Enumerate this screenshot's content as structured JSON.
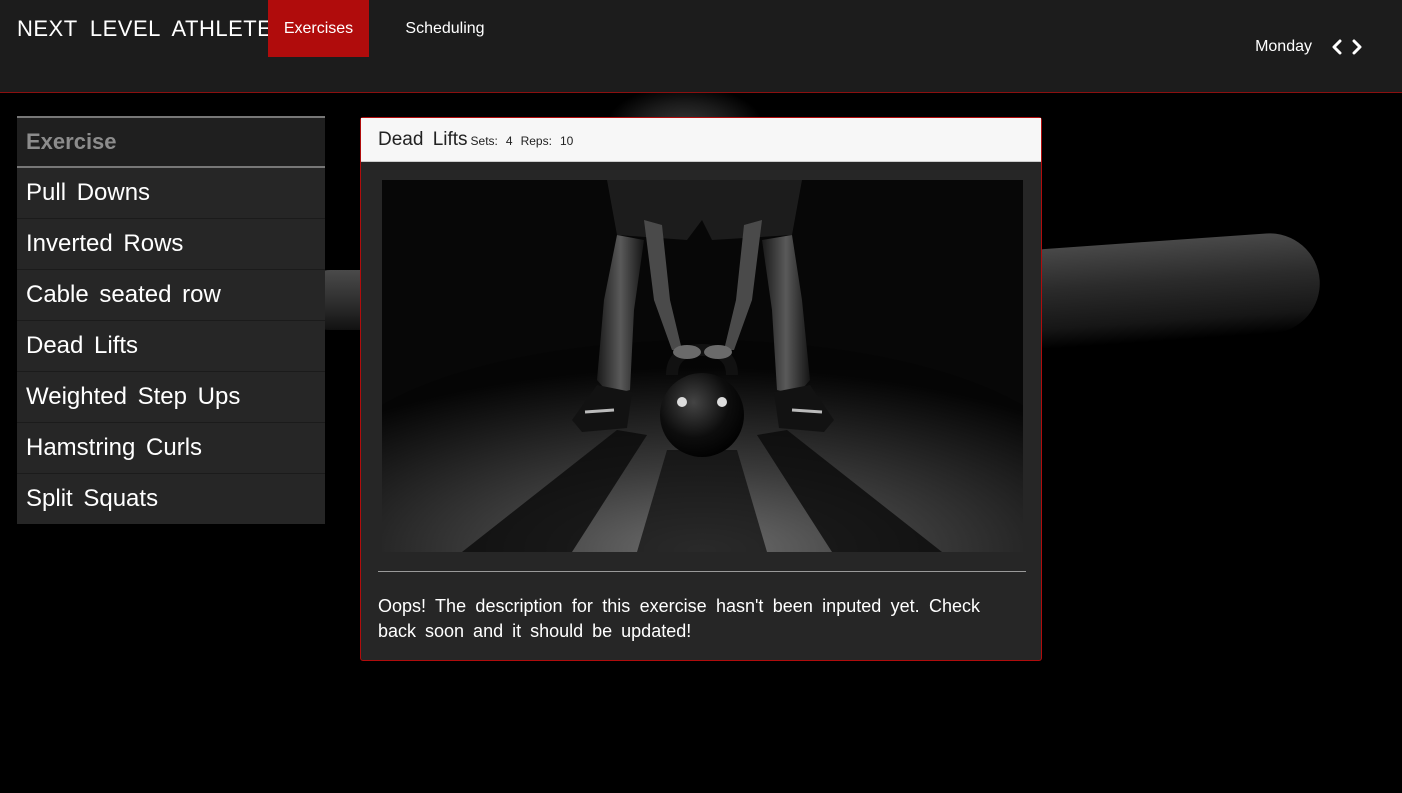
{
  "brand": "NEXT LEVEL ATHLETES",
  "nav": {
    "tabs": [
      {
        "label": "Exercises",
        "active": true
      },
      {
        "label": "Scheduling",
        "active": false
      }
    ]
  },
  "day_nav": {
    "label": "Monday",
    "prev_icon": "chevron-left-icon",
    "next_icon": "chevron-right-icon"
  },
  "sidebar": {
    "header": "Exercise",
    "items": [
      {
        "label": "Pull Downs"
      },
      {
        "label": "Inverted Rows"
      },
      {
        "label": "Cable seated row"
      },
      {
        "label": "Dead Lifts"
      },
      {
        "label": "Weighted Step Ups"
      },
      {
        "label": "Hamstring Curls"
      },
      {
        "label": "Split Squats"
      }
    ]
  },
  "exercise": {
    "title": "Dead Lifts",
    "sets_label": "Sets:",
    "sets": "4",
    "reps_label": "Reps:",
    "reps": "10",
    "image": "kettlebell-deadlift-photo",
    "description": "Oops! The description for this exercise hasn't been inputed yet. Check back soon and it should be updated!"
  },
  "colors": {
    "accent": "#b00c0c",
    "header_bg": "#1c1c1c",
    "panel_bg": "#262626",
    "page_bg": "#000000"
  }
}
